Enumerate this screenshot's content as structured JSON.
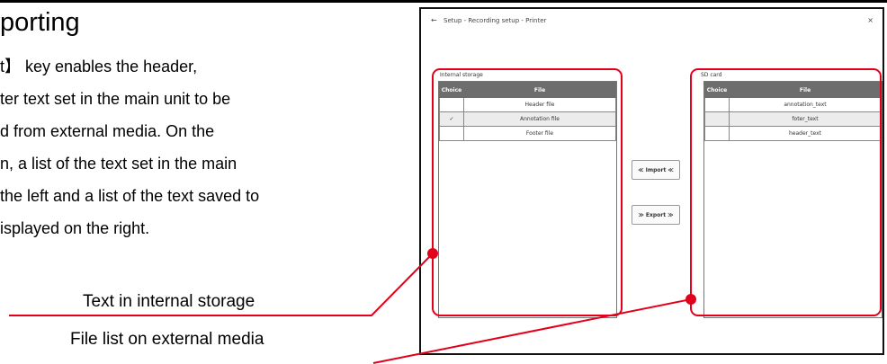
{
  "heading": "porting",
  "paragraph_lines": [
    "t】 key enables the header,",
    "ter text set in the main unit to be",
    "d from external media. On the",
    "n, a list of the text set in the main",
    " the left and a list of the text saved to",
    "isplayed on the right."
  ],
  "callouts": {
    "internal": "Text in internal storage",
    "external": "File list on external media"
  },
  "screen": {
    "title": "Setup - Recording setup - Printer",
    "back_icon": "←",
    "close_icon": "×",
    "left_panel": {
      "title": "Internal storage",
      "headers": [
        "Choice",
        "File"
      ],
      "rows": [
        {
          "checked": false,
          "check_mark": "",
          "file": "Header file"
        },
        {
          "checked": true,
          "check_mark": "✓",
          "file": "Annotation file"
        },
        {
          "checked": false,
          "check_mark": "",
          "file": "Footer file"
        }
      ]
    },
    "right_panel": {
      "title": "SD card",
      "headers": [
        "Choice",
        "File"
      ],
      "rows": [
        {
          "checked": false,
          "check_mark": "",
          "file": "annotation_text"
        },
        {
          "checked": false,
          "check_mark": "",
          "file": "foter_text"
        },
        {
          "checked": false,
          "check_mark": "",
          "file": "header_text"
        }
      ]
    },
    "import_label": "≪ Import ≪",
    "export_label": "≫ Export ≫"
  },
  "colors": {
    "highlight": "#e2001a",
    "table_header": "#6d6d6d"
  }
}
